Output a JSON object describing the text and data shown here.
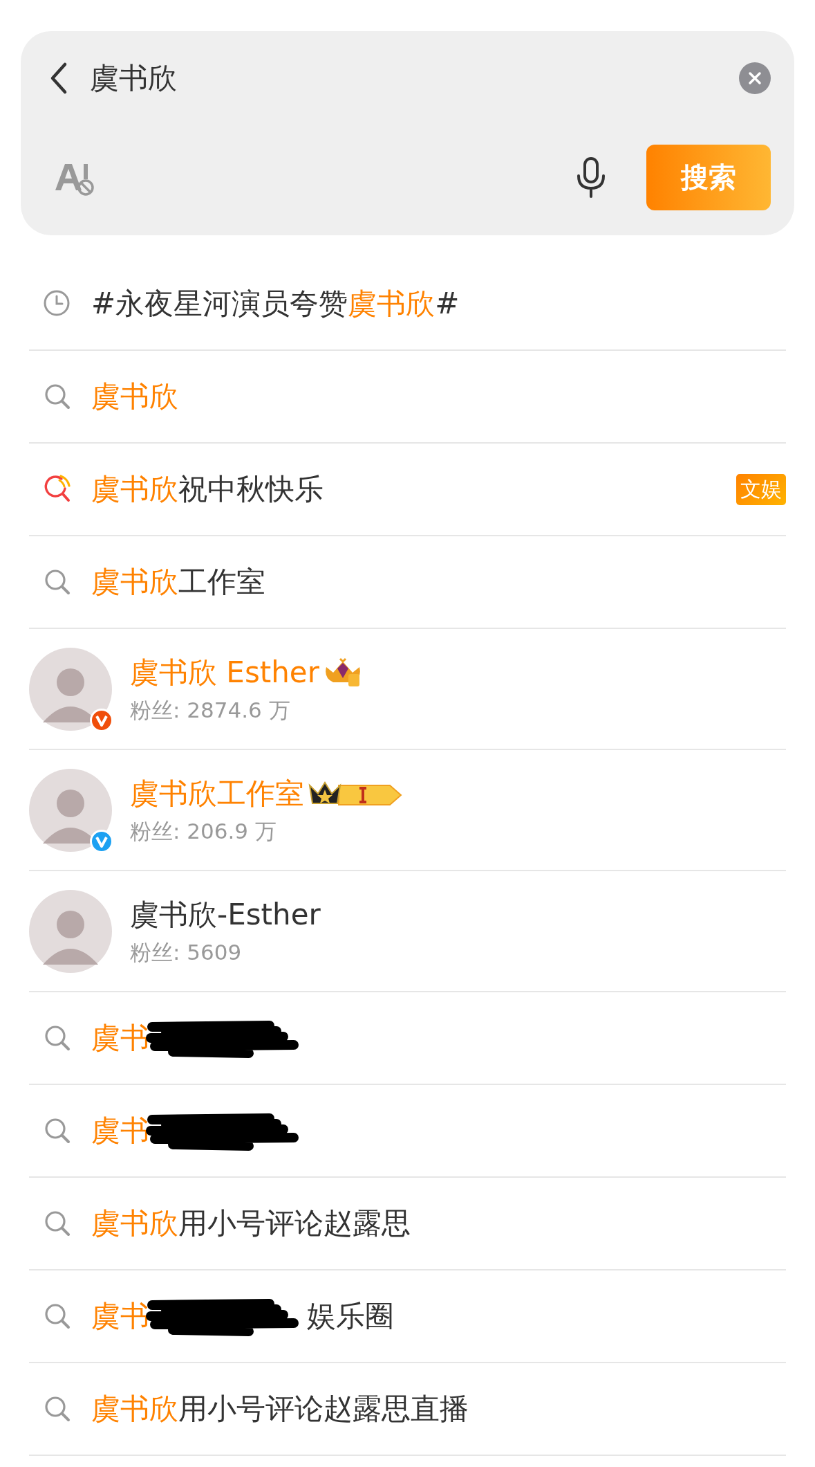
{
  "search_bar": {
    "query": "虞书欣",
    "search_button": "搜索"
  },
  "suggestions": [
    {
      "kind": "history",
      "parts": [
        {
          "text": "#永夜星河演员夸赞",
          "highlight": false
        },
        {
          "text": "虞书欣",
          "highlight": true
        },
        {
          "text": "#",
          "highlight": false
        }
      ]
    },
    {
      "kind": "search",
      "parts": [
        {
          "text": "虞书欣",
          "highlight": true
        }
      ]
    },
    {
      "kind": "hot",
      "parts": [
        {
          "text": "虞书欣",
          "highlight": true
        },
        {
          "text": "祝中秋快乐",
          "highlight": false
        }
      ],
      "tag": "文娱"
    },
    {
      "kind": "search",
      "parts": [
        {
          "text": "虞书欣",
          "highlight": true
        },
        {
          "text": "工作室",
          "highlight": false
        }
      ]
    },
    {
      "kind": "user",
      "parts": [
        {
          "text": "虞书欣 Esther",
          "highlight": true
        }
      ],
      "fans": "粉丝: 2874.6 万",
      "verified": {
        "color": "#f04e0a"
      },
      "badge": {
        "kind": "diamond"
      }
    },
    {
      "kind": "user",
      "parts": [
        {
          "text": "虞书欣工作室",
          "highlight": true
        }
      ],
      "fans": "粉丝: 206.9 万",
      "verified": {
        "color": "#1da1f2"
      },
      "badge": {
        "kind": "level"
      }
    },
    {
      "kind": "user",
      "parts": [
        {
          "text": "虞书欣-Esther",
          "highlight": false
        }
      ],
      "fans": "粉丝: 5609"
    },
    {
      "kind": "search",
      "parts": [
        {
          "text": "虞书",
          "highlight": true
        }
      ],
      "redacted": true
    },
    {
      "kind": "search",
      "parts": [
        {
          "text": "虞书",
          "highlight": true
        }
      ],
      "redacted": true
    },
    {
      "kind": "search",
      "parts": [
        {
          "text": "虞书欣",
          "highlight": true
        },
        {
          "text": "用小号评论赵露思",
          "highlight": false
        }
      ]
    },
    {
      "kind": "search",
      "parts": [
        {
          "text": "虞书",
          "highlight": true
        }
      ],
      "redacted": true,
      "after": "娱乐圈"
    },
    {
      "kind": "search",
      "parts": [
        {
          "text": "虞书欣",
          "highlight": true
        },
        {
          "text": "用小号评论赵露思直播",
          "highlight": false
        }
      ]
    }
  ]
}
